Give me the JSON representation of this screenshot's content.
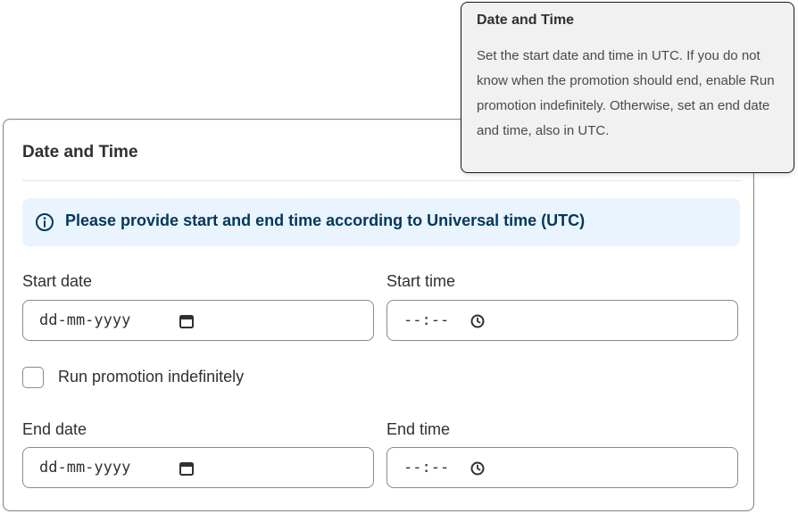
{
  "card": {
    "title": "Date and Time",
    "banner": {
      "icon": "info-icon",
      "text": "Please provide start and end time according to Universal time (UTC)",
      "background": "#eaf4ff",
      "text_color": "#00385c"
    },
    "start_date": {
      "label": "Start date",
      "placeholder": "dd-mm-yyyy",
      "icon": "calendar-icon"
    },
    "start_time": {
      "label": "Start time",
      "placeholder": "--:--",
      "icon": "clock-icon"
    },
    "run_indefinitely": {
      "label": "Run promotion indefinitely",
      "checked": false
    },
    "end_date": {
      "label": "End date",
      "placeholder": "dd-mm-yyyy",
      "icon": "calendar-icon"
    },
    "end_time": {
      "label": "End time",
      "placeholder": "--:--",
      "icon": "clock-icon"
    }
  },
  "tooltip": {
    "title": "Date and Time",
    "body": "Set the start date and time in UTC. If you do not know when the promotion should end, enable Run promotion indefinitely. Otherwise, set an end date and time, also in UTC."
  }
}
